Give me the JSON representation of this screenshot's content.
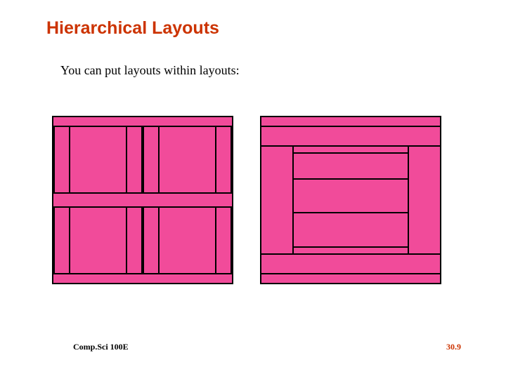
{
  "title": "Hierarchical Layouts",
  "subtitle": "You can put layouts within layouts:",
  "footer": {
    "left": "Comp.Sci 100E",
    "right": "30.9"
  },
  "colors": {
    "accent": "#cc3300",
    "fill": "#f14b9a",
    "border": "#000000"
  }
}
